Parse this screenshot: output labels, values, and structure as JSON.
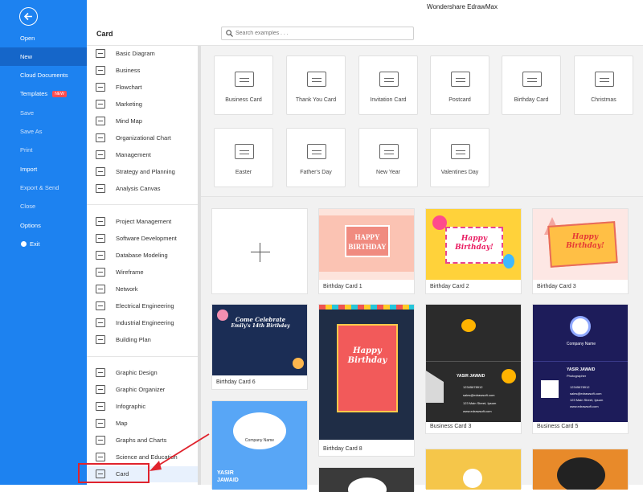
{
  "app": {
    "title": "Wondershare EdrawMax"
  },
  "left_menu": {
    "items": [
      {
        "label": "Open"
      },
      {
        "label": "New"
      },
      {
        "label": "Cloud Documents"
      },
      {
        "label": "Templates"
      },
      {
        "label": "Save"
      },
      {
        "label": "Save As"
      },
      {
        "label": "Print"
      },
      {
        "label": "Import"
      },
      {
        "label": "Export & Send"
      },
      {
        "label": "Close"
      },
      {
        "label": "Options"
      },
      {
        "label": "Exit"
      }
    ],
    "templates_badge": "NEW"
  },
  "section": {
    "title": "Card"
  },
  "search": {
    "placeholder": "Search examples . . ."
  },
  "categories": {
    "group1": [
      "Basic Diagram",
      "Business",
      "Flowchart",
      "Marketing",
      "Mind Map",
      "Organizational Chart",
      "Management",
      "Strategy and Planning",
      "Analysis Canvas"
    ],
    "group2": [
      "Project Management",
      "Software Development",
      "Database Modeling",
      "Wireframe",
      "Network",
      "Electrical Engineering",
      "Industrial Engineering",
      "Building Plan"
    ],
    "group3": [
      "Graphic Design",
      "Graphic Organizer",
      "Infographic",
      "Map",
      "Graphs and Charts",
      "Science and Education",
      "Card"
    ]
  },
  "subcategories": [
    "Business Card",
    "Thank You Card",
    "Invitation Card",
    "Postcard",
    "Birthday Card",
    "Christmas",
    "Easter",
    "Father's Day",
    "New Year",
    "Valentines Day"
  ],
  "templates": {
    "cards": [
      "Birthday Card 1",
      "Birthday Card 2",
      "Birthday Card 3",
      "Birthday Card 6",
      "Birthday Card 8",
      "Business Card 3",
      "Business Card 5"
    ],
    "thumbs": {
      "happy_birthday_caps": "HAPPY BIRTHDAY",
      "happy_birthday": "Happy Birthday!",
      "happy": "Happy",
      "birthday": "Birthday",
      "come_celebrate": "Come Celebrate",
      "emilys_birthday": "Emily's 14th Birthday",
      "yasir": "YASIR JAWAID",
      "yasir_first": "YASIR",
      "yasir_last": "JAWAID",
      "photographer": "Photographer",
      "company_name": "Company Name",
      "phone": "12345678912",
      "email": "sales@edrawsoft.com",
      "address": "123 Main Street, Ipsum",
      "web": "www.edrawsoft.com"
    }
  },
  "colors": {
    "primary": "#1d82f0",
    "highlight_red": "#e0232d"
  }
}
